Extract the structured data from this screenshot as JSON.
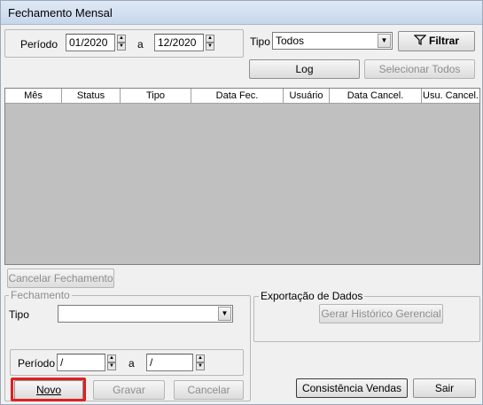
{
  "window": {
    "title": "Fechamento Mensal"
  },
  "filter": {
    "periodo_label": "Período",
    "periodo_start": "01/2020",
    "periodo_sep": "a",
    "periodo_end": "12/2020",
    "tipo_label": "Tipo",
    "tipo_value": "Todos",
    "filtrar_label": "Filtrar"
  },
  "actions": {
    "log_label": "Log",
    "selecionar_todos_label": "Selecionar Todos"
  },
  "grid": {
    "columns": [
      "Mês",
      "Status",
      "Tipo",
      "Data Fec.",
      "Usuário",
      "Data Cancel.",
      "Usu. Cancel."
    ],
    "rows": []
  },
  "cancelar_fechamento_label": "Cancelar Fechamento",
  "fechamento": {
    "legend": "Fechamento",
    "tipo_label": "Tipo",
    "tipo_value": "",
    "periodo_label": "Período",
    "periodo_start": "/",
    "periodo_sep": "a",
    "periodo_end": "/"
  },
  "exportacao": {
    "legend": "Exportação de Dados",
    "gerar_label": "Gerar Histórico Gerencial"
  },
  "bottom_buttons": {
    "novo": "Novo",
    "gravar": "Gravar",
    "cancelar": "Cancelar",
    "consistencia": "Consistência Vendas",
    "sair": "Sair"
  },
  "colors": {
    "highlight": "#e02020",
    "grid_bg": "#c0c0c0"
  }
}
